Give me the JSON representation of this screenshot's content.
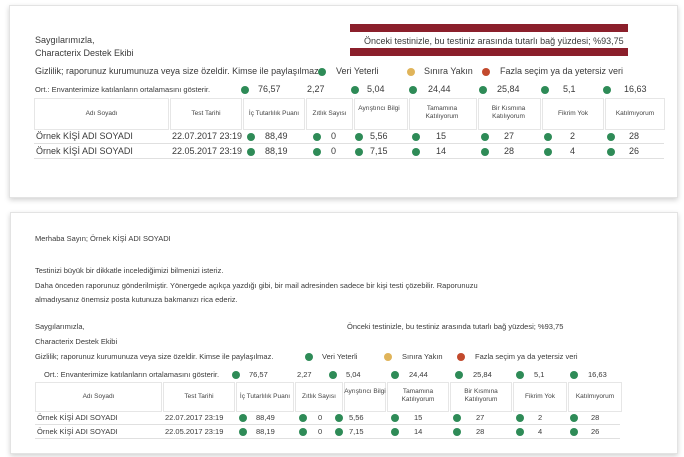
{
  "card1": {
    "signoff": "Saygılarımızla,",
    "team": "Characterix Destek Ekibi",
    "consistency": "Önceki testinizle, bu testiniz arasında tutarlı bağ yüzdesi; %93,75",
    "privacy": "Gizlilik; raporunuz kurumunuza veya size özeldir. Kimse ile paylaşılmaz.",
    "legend": {
      "green": "Veri Yeterli",
      "yellow": "Sınıra Yakın",
      "red": "Fazla seçim ya da yetersiz veri"
    },
    "avg_label": "Ort.: Envanterimize katılanların ortalamasını gösterir.",
    "averages": [
      "76,57",
      "2,27",
      "5,04",
      "24,44",
      "25,84",
      "5,1",
      "16,63"
    ],
    "headers": [
      "Adı Soyadı",
      "Test Tarihi",
      "İç Tutarlılık Puanı",
      "Zıtlık Sayısı",
      "Ayrıştırıcı Bilgi",
      "Tamamına Katılıyorum",
      "Bir Kısmına Katılıyorum",
      "Fikrim Yok",
      "Katılmıyorum"
    ],
    "rows": [
      {
        "name": "Örnek KİŞİ ADI SOYADI",
        "date": "22.07.2017 23:19",
        "v": [
          "88,49",
          "0",
          "5,56",
          "15",
          "27",
          "2",
          "28"
        ]
      },
      {
        "name": "Örnek KİŞİ ADI SOYADI",
        "date": "22.05.2017 23:19",
        "v": [
          "88,19",
          "0",
          "7,15",
          "14",
          "28",
          "4",
          "26"
        ]
      }
    ]
  },
  "card2": {
    "greeting": "Merhaba Sayın; Örnek KİŞİ ADI SOYADI",
    "para1": "Testinizi büyük bir dikkatle incelediğimizi bilmenizi isteriz.",
    "para2a": "Daha önceden raporunuz gönderilmiştir. Yönergede açıkça yazdığı gibi, bir mail adresinden sadece bir kişi testi çözebilir. Raporunuzu",
    "para2b": "almadıysanız önemsiz posta kutunuza bakmanızı rica ederiz.",
    "signoff": "Saygılarımızla,",
    "team": "Characterix Destek Ekibi",
    "consistency": "Önceki testinizle, bu testiniz arasında tutarlı bağ yüzdesi; %93,75",
    "privacy": "Gizlilik; raporunuz kurumunuza veya size özeldir. Kimse ile paylaşılmaz.",
    "legend": {
      "green": "Veri Yeterli",
      "yellow": "Sınıra Yakın",
      "red": "Fazla seçim ya da yetersiz veri"
    },
    "avg_label": "Ort.: Envanterimize katılanların ortalamasını gösterir.",
    "averages": [
      "76,57",
      "2,27",
      "5,04",
      "24,44",
      "25,84",
      "5,1",
      "16,63"
    ],
    "headers": [
      "Adı Soyadı",
      "Test Tarihi",
      "İç Tutarlılık Puanı",
      "Zıtlık Sayısı",
      "Ayrıştırıcı Bilgi",
      "Tamamına Katılıyorum",
      "Bir Kısmına Katılıyorum",
      "Fikrim Yok",
      "Katılmıyorum"
    ],
    "rows": [
      {
        "name": "Örnek KİŞİ ADI SOYADI",
        "date": "22.07.2017 23:19",
        "v": [
          "88,49",
          "0",
          "5,56",
          "15",
          "27",
          "2",
          "28"
        ]
      },
      {
        "name": "Örnek KİŞİ ADI SOYADI",
        "date": "22.05.2017 23:19",
        "v": [
          "88,19",
          "0",
          "7,15",
          "14",
          "28",
          "4",
          "26"
        ]
      }
    ]
  },
  "colors": {
    "banner": "#8b1f2b",
    "green": "#2e8b57",
    "yellow": "#e0b45a",
    "red": "#c24a2d"
  }
}
